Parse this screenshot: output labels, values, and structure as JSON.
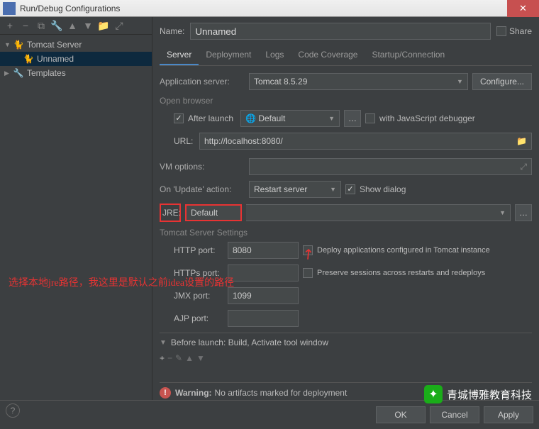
{
  "window": {
    "title": "Run/Debug Configurations"
  },
  "sidebar": {
    "items": [
      {
        "label": "Tomcat Server"
      },
      {
        "label": "Unnamed"
      },
      {
        "label": "Templates"
      }
    ]
  },
  "nameRow": {
    "label": "Name:",
    "value": "Unnamed",
    "share": "Share"
  },
  "tabs": [
    "Server",
    "Deployment",
    "Logs",
    "Code Coverage",
    "Startup/Connection"
  ],
  "appServer": {
    "label": "Application server:",
    "value": "Tomcat 8.5.29",
    "configure": "Configure..."
  },
  "openBrowser": {
    "title": "Open browser",
    "afterLaunch": "After launch",
    "browser": "Default",
    "jsDebug": "with JavaScript debugger",
    "urlLabel": "URL:",
    "urlValue": "http://localhost:8080/"
  },
  "vmOptions": {
    "label": "VM options:"
  },
  "updateAction": {
    "label": "On 'Update' action:",
    "value": "Restart server",
    "showDialog": "Show dialog"
  },
  "jre": {
    "label": "JRE:",
    "value": "Default"
  },
  "tomcatSettings": {
    "title": "Tomcat Server Settings",
    "httpPort": {
      "label": "HTTP port:",
      "value": "8080"
    },
    "deployCheck": "Deploy applications configured in Tomcat instance",
    "httpsPort": {
      "label": "HTTPs port:"
    },
    "preserveCheck": "Preserve sessions across restarts and redeploys",
    "jmxPort": {
      "label": "JMX port:",
      "value": "1099"
    },
    "ajpPort": {
      "label": "AJP port:"
    }
  },
  "beforeLaunch": {
    "title": "Before launch: Build, Activate tool window"
  },
  "warning": {
    "label": "Warning:",
    "text": "No artifacts marked for deployment"
  },
  "footer": {
    "ok": "OK",
    "cancel": "Cancel",
    "apply": "Apply"
  },
  "annotation": "选择本地jre路径，我这里是默认之前idea设置的路径",
  "watermark": "青城博雅教育科技"
}
